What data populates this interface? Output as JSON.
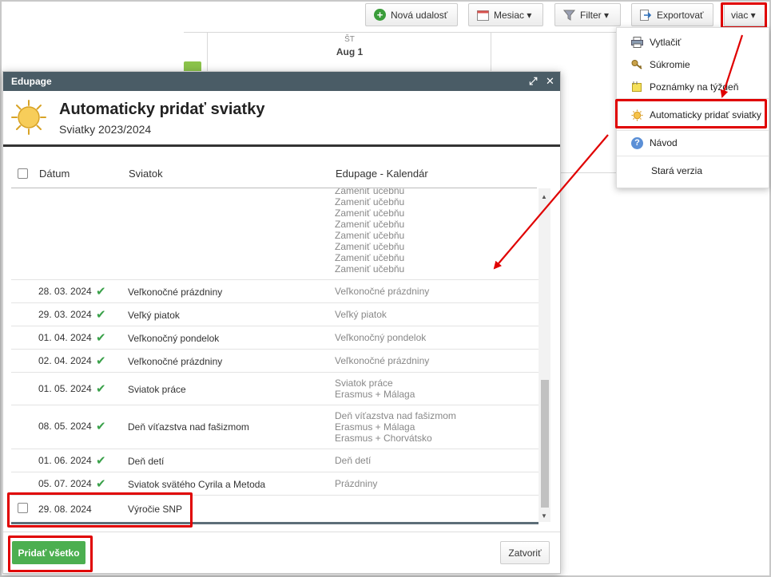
{
  "toolbar": {
    "new_event": "Nová udalosť",
    "month": "Mesiac ▾",
    "filter": "Filter ▾",
    "export": "Exportovať",
    "more": "viac ▾"
  },
  "calendar": {
    "day_abbr": "ŠT",
    "day_date": "Aug 1"
  },
  "dropdown": {
    "items": [
      {
        "label": "Vytlačiť",
        "icon": "printer-icon"
      },
      {
        "label": "Súkromie",
        "icon": "key-icon"
      },
      {
        "label": "Poznámky na týždeň",
        "icon": "note-icon"
      },
      {
        "label": "Automaticky pridať sviatky",
        "icon": "sun-icon"
      },
      {
        "label": "Návod",
        "icon": "help-icon"
      },
      {
        "label": "Stará verzia",
        "icon": ""
      }
    ]
  },
  "dialog": {
    "window_title": "Edupage",
    "heading": "Automaticky pridať sviatky",
    "subheading": "Sviatky 2023/2024",
    "columns": {
      "date": "Dátum",
      "holiday": "Sviatok",
      "calendar": "Edupage - Kalendár"
    },
    "overflow_lines": [
      "Zameniť učebňu",
      "Zameniť učebňu",
      "Zameniť učebňu",
      "Zameniť učebňu",
      "Zameniť učebňu",
      "Zameniť učebňu",
      "Zameniť učebňu",
      "Zameniť učebňu"
    ],
    "rows": [
      {
        "date": "28. 03. 2024",
        "checked": true,
        "name": "Veľkonočné prázdniny",
        "cal": [
          "Veľkonočné prázdniny"
        ]
      },
      {
        "date": "29. 03. 2024",
        "checked": true,
        "name": "Veľký piatok",
        "cal": [
          "Veľký piatok"
        ]
      },
      {
        "date": "01. 04. 2024",
        "checked": true,
        "name": "Veľkonočný pondelok",
        "cal": [
          "Veľkonočný pondelok"
        ]
      },
      {
        "date": "02. 04. 2024",
        "checked": true,
        "name": "Veľkonočné prázdniny",
        "cal": [
          "Veľkonočné prázdniny"
        ]
      },
      {
        "date": "01. 05. 2024",
        "checked": true,
        "name": "Sviatok práce",
        "cal": [
          "Sviatok práce",
          "Erasmus + Málaga"
        ]
      },
      {
        "date": "08. 05. 2024",
        "checked": true,
        "name": "Deň víťazstva nad fašizmom",
        "cal": [
          "Deň víťazstva nad fašizmom",
          "Erasmus + Málaga",
          "Erasmus + Chorvátsko"
        ]
      },
      {
        "date": "01. 06. 2024",
        "checked": true,
        "name": "Deň detí",
        "cal": [
          "Deň detí"
        ]
      },
      {
        "date": "05. 07. 2024",
        "checked": true,
        "name": "Sviatok svätého Cyrila a Metoda",
        "cal": [
          "Prázdniny"
        ]
      },
      {
        "date": "29. 08. 2024",
        "checked": false,
        "name": "Výročie SNP",
        "cal": []
      }
    ],
    "add_all": "Pridať všetko",
    "close": "Zatvoriť"
  },
  "colors": {
    "title_bar": "#4a5c66",
    "add_button": "#4caf50",
    "highlight": "#e00000",
    "check": "#3aa14a"
  }
}
